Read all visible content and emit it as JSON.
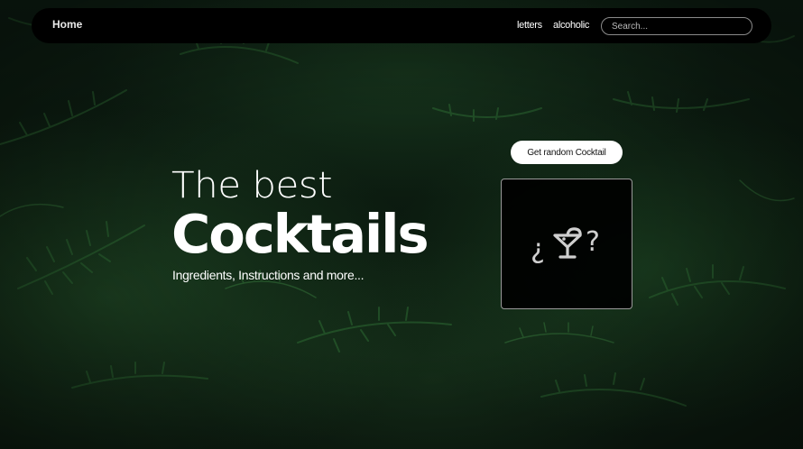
{
  "navbar": {
    "home_label": "Home",
    "links": [
      "letters",
      "alcoholic"
    ],
    "search_placeholder": "Search..."
  },
  "hero": {
    "line1": "The best",
    "line2": "Cocktails",
    "subtitle": "Ingredients, Instructions and more..."
  },
  "random_panel": {
    "button_label": "Get random Cocktail",
    "placeholder_left": "¿",
    "placeholder_icon": "cocktail-glass-icon",
    "placeholder_right": "?"
  },
  "colors": {
    "navbar_bg": "#000000",
    "background": "#0c1a10",
    "text": "#ffffff",
    "card_border": "#9a9a9a"
  }
}
